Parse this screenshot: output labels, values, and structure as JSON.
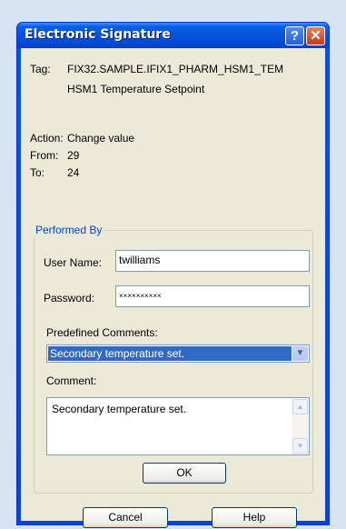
{
  "window": {
    "title": "Electronic Signature",
    "help_glyph": "?",
    "close_glyph": "✕"
  },
  "tag": {
    "label": "Tag:",
    "value": "FIX32.SAMPLE.IFIX1_PHARM_HSM1_TEM",
    "description": "HSM1 Temperature Setpoint"
  },
  "action": {
    "label": "Action:",
    "value": "Change value"
  },
  "from": {
    "label": "From:",
    "value": "29"
  },
  "to": {
    "label": "To:",
    "value": "24"
  },
  "performed_by": {
    "legend": "Performed By",
    "user_name_label": "User Name:",
    "user_name_value": "twilliams",
    "password_label": "Password:",
    "password_value": "××××××××××",
    "predefined_label": "Predefined Comments:",
    "predefined_selected": "Secondary temperature set.",
    "comment_label": "Comment:",
    "comment_value": "Secondary temperature set.",
    "ok_label": "OK"
  },
  "buttons": {
    "cancel": "Cancel",
    "help": "Help"
  },
  "colors": {
    "accent": "#0046d5",
    "selection": "#316ac5",
    "title_bar": "#0653dd"
  }
}
